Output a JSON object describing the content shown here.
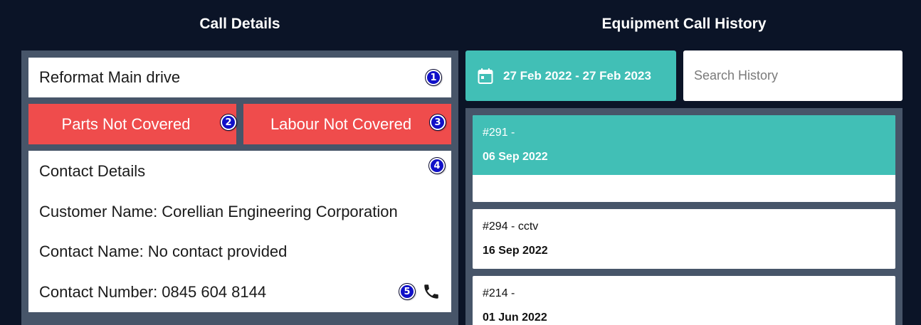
{
  "call_details": {
    "title": "Call Details",
    "job_title": "Reformat Main drive",
    "parts_button": "Parts Not Covered",
    "labour_button": "Labour Not Covered",
    "contact": {
      "heading": "Contact Details",
      "customer_label": "Customer Name:",
      "customer_value": "Corellian Engineering Corporation",
      "contact_label": "Contact Name:",
      "contact_value": "No contact provided",
      "number_label": "Contact Number:",
      "number_value": "0845 604 8144"
    },
    "badges": [
      "1",
      "2",
      "3",
      "4",
      "5"
    ]
  },
  "history": {
    "title": "Equipment Call History",
    "date_range": "27 Feb 2022 - 27 Feb 2023",
    "search_placeholder": "Search History",
    "calls": [
      {
        "title": "#291 -",
        "date": "06 Sep 2022",
        "selected": true
      },
      {
        "title": "#294 - cctv",
        "date": "16 Sep 2022",
        "selected": false
      },
      {
        "title": "#214 -",
        "date": "01 Jun 2022",
        "selected": false
      }
    ]
  },
  "icons": {
    "calendar": "calendar-icon",
    "phone": "phone-icon"
  },
  "colors": {
    "background": "#0b1427",
    "panel": "#475569",
    "accent_teal": "#41bfb6",
    "warning_red": "#ef4c4c",
    "badge_blue": "#1010c8"
  }
}
